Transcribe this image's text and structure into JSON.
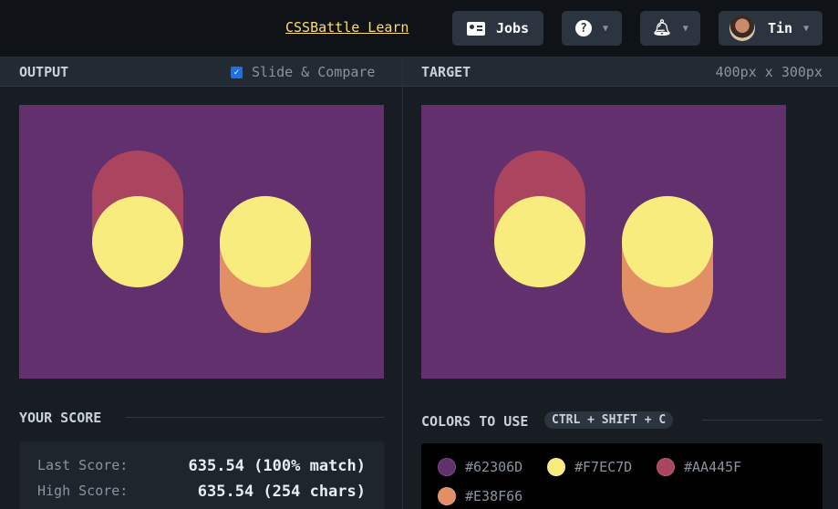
{
  "topbar": {
    "learn_link": "CSSBattle Learn",
    "jobs_label": "Jobs",
    "user_name": "Tin"
  },
  "output_panel": {
    "title": "OUTPUT",
    "slide_compare_label": "Slide & Compare",
    "slide_compare_checked": true
  },
  "target_panel": {
    "title": "TARGET",
    "dimensions": "400px x 300px"
  },
  "canvas_colors": {
    "background": "#62306D",
    "circle": "#F7EC7D",
    "top_pill": "#AA445F",
    "bottom_pill": "#E38F66"
  },
  "score": {
    "title": "YOUR SCORE",
    "last_label": "Last Score:",
    "last_value": "635.54 (100% match)",
    "high_label": "High Score:",
    "high_value": "635.54 (254 chars)"
  },
  "colors_to_use": {
    "title": "COLORS TO USE",
    "shortcut": "CTRL + SHIFT + C",
    "swatches": [
      {
        "hex": "#62306D",
        "label": "#62306D"
      },
      {
        "hex": "#F7EC7D",
        "label": "#F7EC7D"
      },
      {
        "hex": "#AA445F",
        "label": "#AA445F"
      },
      {
        "hex": "#E38F66",
        "label": "#E38F66"
      }
    ]
  }
}
